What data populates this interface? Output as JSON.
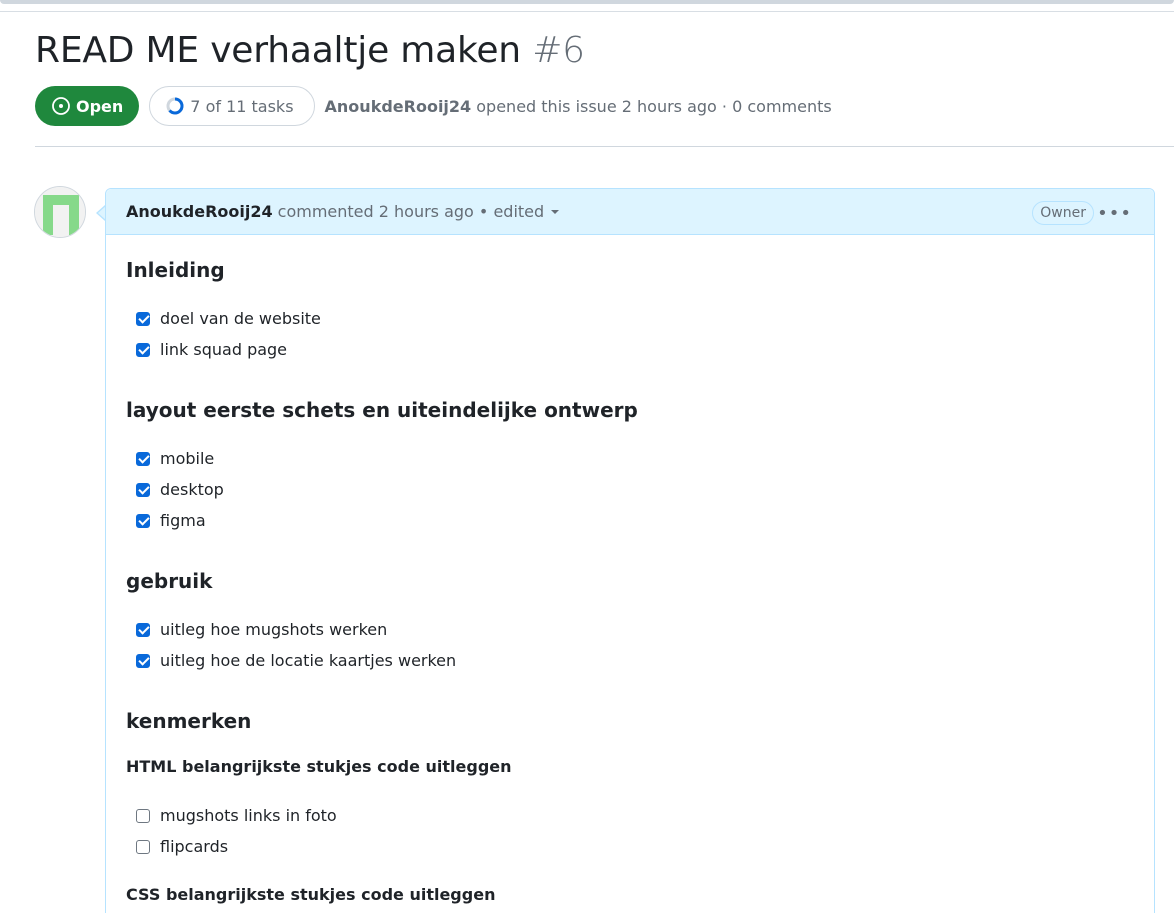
{
  "issue": {
    "title": "READ ME verhaaltje maken",
    "number": "#6",
    "state": "Open",
    "tasks_summary": "7 of 11 tasks",
    "tasks_done": 7,
    "tasks_total": 11,
    "author": "AnoukdeRooij24",
    "opened_text": "opened this issue 2 hours ago · 0 comments"
  },
  "comment": {
    "author": "AnoukdeRooij24",
    "meta": "commented 2 hours ago • edited",
    "badge": "Owner",
    "sections": [
      {
        "heading": "Inleiding",
        "tasks": [
          {
            "label": "doel van de website",
            "checked": true
          },
          {
            "label": "link squad page",
            "checked": true
          }
        ]
      },
      {
        "heading": "layout eerste schets en uiteindelijke ontwerp",
        "tasks": [
          {
            "label": "mobile",
            "checked": true
          },
          {
            "label": "desktop",
            "checked": true
          },
          {
            "label": "figma",
            "checked": true
          }
        ]
      },
      {
        "heading": "gebruik",
        "tasks": [
          {
            "label": "uitleg hoe mugshots werken",
            "checked": true
          },
          {
            "label": "uitleg hoe de locatie kaartjes werken",
            "checked": true
          }
        ]
      },
      {
        "heading": "kenmerken",
        "subheading": "HTML belangrijkste stukjes code uitleggen",
        "tasks": [
          {
            "label": "mugshots links in foto",
            "checked": false
          },
          {
            "label": "flipcards",
            "checked": false
          }
        ]
      }
    ],
    "subheading2": "CSS belangrijkste stukjes code uitleggen"
  },
  "colors": {
    "open_green": "#1f883d",
    "checkbox_blue": "#0969da",
    "header_blue": "#ddf4ff",
    "border_blue": "#b6e3ff"
  }
}
